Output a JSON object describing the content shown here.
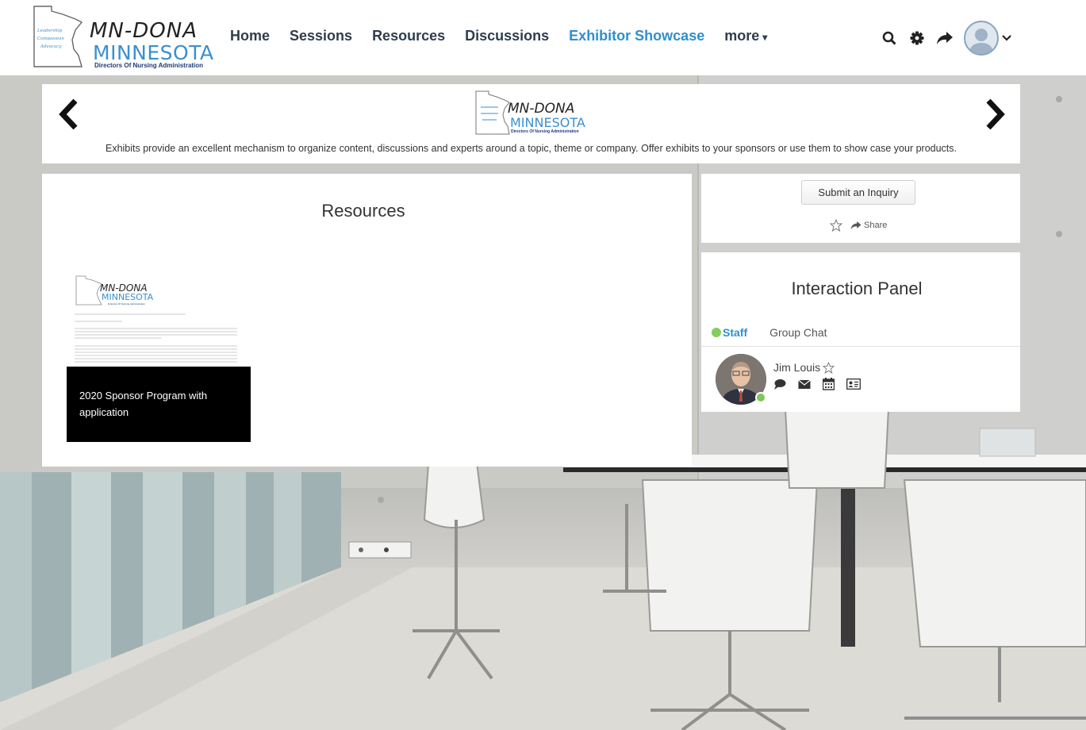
{
  "header": {
    "logo": {
      "title": "MN-DONA",
      "state": "MINNESOTA",
      "subtitle": "Directors Of Nursing Administration",
      "map_words": [
        "Leadership",
        "Compassion",
        "Advocacy"
      ]
    },
    "nav": [
      {
        "label": "Home",
        "active": false
      },
      {
        "label": "Sessions",
        "active": false
      },
      {
        "label": "Resources",
        "active": false
      },
      {
        "label": "Discussions",
        "active": false
      },
      {
        "label": "Exhibitor Showcase",
        "active": true
      },
      {
        "label": "more",
        "active": false
      }
    ],
    "icons": [
      "search-icon",
      "gear-icon",
      "share-arrow-icon",
      "user-avatar-icon",
      "chevron-down-icon"
    ]
  },
  "banner": {
    "logo_title": "MN-DONA",
    "logo_state": "MINNESOTA",
    "logo_subtitle": "Directors Of Nursing Administration",
    "description": "Exhibits provide an excellent mechanism to organize content, discussions and experts around a topic, theme or company. Offer exhibits to your sponsors or use them to show case your products."
  },
  "resources": {
    "title": "Resources",
    "items": [
      {
        "caption": "2020 Sponsor Program with application",
        "thumb_title": "MN-DONA",
        "thumb_state": "MINNESOTA",
        "thumb_subtitle": "Directors Of Nursing Administration"
      }
    ]
  },
  "inquiry": {
    "button_label": "Submit an Inquiry",
    "share_label": "Share"
  },
  "interaction": {
    "title": "Interaction Panel",
    "tabs": [
      {
        "label": "Staff",
        "active": true
      },
      {
        "label": "Group Chat",
        "active": false
      }
    ],
    "staff": [
      {
        "name": "Jim Louis",
        "online": true,
        "actions": [
          "chat-bubble-icon",
          "envelope-icon",
          "calendar-icon",
          "contact-card-icon"
        ]
      }
    ]
  },
  "colors": {
    "accent": "#2e8fcf",
    "nav_text": "#2f3d4d",
    "online": "#7cc85a",
    "caption_bg": "#000000"
  }
}
